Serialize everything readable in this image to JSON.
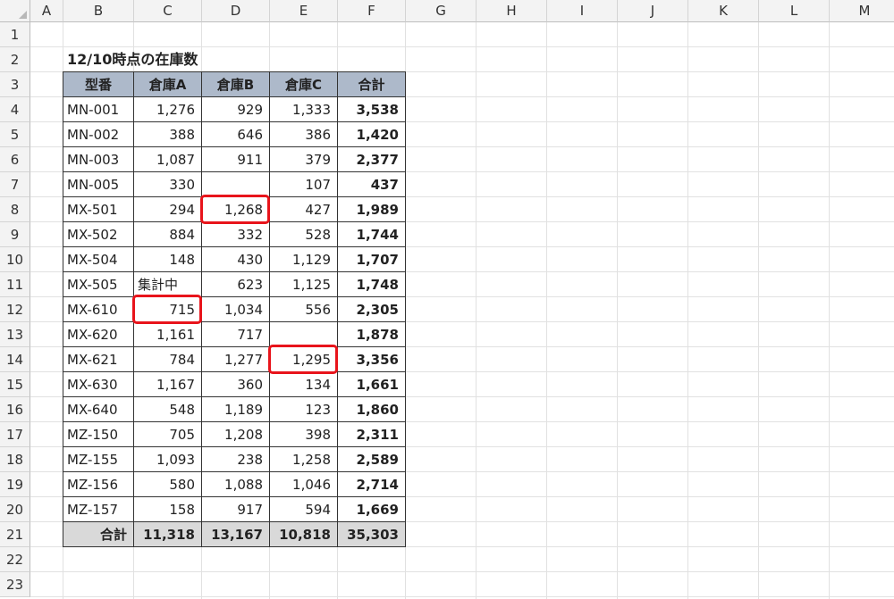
{
  "columns": [
    "A",
    "B",
    "C",
    "D",
    "E",
    "F",
    "G",
    "H",
    "I",
    "J",
    "K",
    "L",
    "M"
  ],
  "rows": [
    "1",
    "2",
    "3",
    "4",
    "5",
    "6",
    "7",
    "8",
    "9",
    "10",
    "11",
    "12",
    "13",
    "14",
    "15",
    "16",
    "17",
    "18",
    "19",
    "20",
    "21",
    "22",
    "23"
  ],
  "title": "12/10時点の在庫数",
  "table": {
    "headers": [
      "型番",
      "倉庫A",
      "倉庫B",
      "倉庫C",
      "合計"
    ],
    "rows": [
      [
        "MN-001",
        "1,276",
        "929",
        "1,333",
        "3,538"
      ],
      [
        "MN-002",
        "388",
        "646",
        "386",
        "1,420"
      ],
      [
        "MN-003",
        "1,087",
        "911",
        "379",
        "2,377"
      ],
      [
        "MN-005",
        "330",
        "",
        "107",
        "437"
      ],
      [
        "MX-501",
        "294",
        "1,268",
        "427",
        "1,989"
      ],
      [
        "MX-502",
        "884",
        "332",
        "528",
        "1,744"
      ],
      [
        "MX-504",
        "148",
        "430",
        "1,129",
        "1,707"
      ],
      [
        "MX-505",
        "集計中",
        "623",
        "1,125",
        "1,748"
      ],
      [
        "MX-610",
        "715",
        "1,034",
        "556",
        "2,305"
      ],
      [
        "MX-620",
        "1,161",
        "717",
        "",
        "1,878"
      ],
      [
        "MX-621",
        "784",
        "1,277",
        "1,295",
        "3,356"
      ],
      [
        "MX-630",
        "1,167",
        "360",
        "134",
        "1,661"
      ],
      [
        "MX-640",
        "548",
        "1,189",
        "123",
        "1,860"
      ],
      [
        "MZ-150",
        "705",
        "1,208",
        "398",
        "2,311"
      ],
      [
        "MZ-155",
        "1,093",
        "238",
        "1,258",
        "2,589"
      ],
      [
        "MZ-156",
        "580",
        "1,088",
        "1,046",
        "2,714"
      ],
      [
        "MZ-157",
        "158",
        "917",
        "594",
        "1,669"
      ]
    ],
    "total_row": [
      "合計",
      "11,318",
      "13,167",
      "10,818",
      "35,303"
    ]
  },
  "highlight_color": "#e8141b",
  "highlights": [
    {
      "row": 4,
      "col": 2
    },
    {
      "row": 8,
      "col": 1
    },
    {
      "row": 10,
      "col": 3
    }
  ]
}
